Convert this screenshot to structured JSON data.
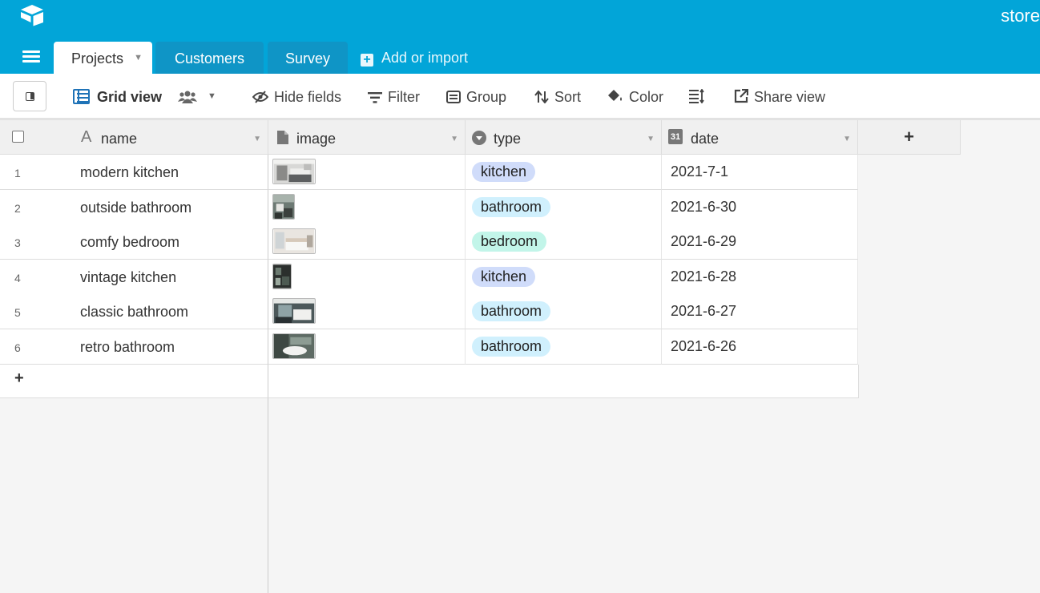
{
  "header": {
    "base_name": "store",
    "tabs": [
      {
        "label": "Projects",
        "active": true
      },
      {
        "label": "Customers",
        "active": false
      },
      {
        "label": "Survey",
        "active": false
      }
    ],
    "add_import_label": "Add or import",
    "colors": {
      "topbar": "#02a5d8",
      "tab_inactive": "#0f95c6"
    }
  },
  "toolbar": {
    "view_name": "Grid view",
    "hide_fields": "Hide fields",
    "filter": "Filter",
    "group": "Group",
    "sort": "Sort",
    "color": "Color",
    "share_view": "Share view"
  },
  "table": {
    "columns": [
      {
        "key": "name",
        "label": "name",
        "icon": "text-field-icon"
      },
      {
        "key": "image",
        "label": "image",
        "icon": "attachment-field-icon"
      },
      {
        "key": "type",
        "label": "type",
        "icon": "single-select-field-icon"
      },
      {
        "key": "date",
        "label": "date",
        "icon": "date-field-icon",
        "icon_text": "31"
      }
    ],
    "rows": [
      {
        "num": "1",
        "name": "modern kitchen",
        "type": "kitchen",
        "date": "2021-7-1"
      },
      {
        "num": "2",
        "name": "outside bathroom",
        "type": "bathroom",
        "date": "2021-6-30"
      },
      {
        "num": "3",
        "name": "comfy bedroom",
        "type": "bedroom",
        "date": "2021-6-29"
      },
      {
        "num": "4",
        "name": "vintage kitchen",
        "type": "kitchen",
        "date": "2021-6-28"
      },
      {
        "num": "5",
        "name": "classic bathroom",
        "type": "bathroom",
        "date": "2021-6-27"
      },
      {
        "num": "6",
        "name": "retro bathroom",
        "type": "bathroom",
        "date": "2021-6-26"
      }
    ],
    "type_colors": {
      "kitchen": "#d0dcfa",
      "bathroom": "#d0f0fd",
      "bedroom": "#c2f5e9"
    }
  }
}
